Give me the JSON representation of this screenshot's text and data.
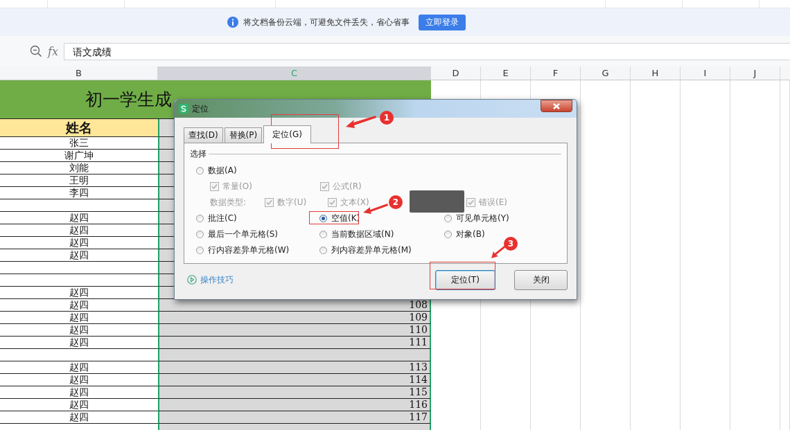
{
  "notice_bar": {
    "message": "将文档备份云端，可避免文件丢失，省心省事",
    "button": "立即登录"
  },
  "formula_bar": {
    "fx": "fx",
    "value": "语文成绩"
  },
  "columns": [
    {
      "label": "B",
      "selected": false
    },
    {
      "label": "C",
      "selected": true
    },
    {
      "label": "D",
      "selected": false
    },
    {
      "label": "E",
      "selected": false
    },
    {
      "label": "F",
      "selected": false
    },
    {
      "label": "G",
      "selected": false
    },
    {
      "label": "H",
      "selected": false
    },
    {
      "label": "I",
      "selected": false
    },
    {
      "label": "J",
      "selected": false
    }
  ],
  "sheet": {
    "title": "初一学生成",
    "header": "姓名",
    "rows": [
      {
        "kind": "entry",
        "name": "张三"
      },
      {
        "kind": "entry",
        "name": "谢广坤"
      },
      {
        "kind": "entry",
        "name": "刘能"
      },
      {
        "kind": "entry",
        "name": "王明"
      },
      {
        "kind": "entry",
        "name": "李四"
      },
      {
        "kind": "blank"
      },
      {
        "kind": "entry",
        "name": "赵四"
      },
      {
        "kind": "entry",
        "name": "赵四"
      },
      {
        "kind": "entry",
        "name": "赵四"
      },
      {
        "kind": "entry",
        "name": "赵四"
      },
      {
        "kind": "blank"
      },
      {
        "kind": "blank"
      },
      {
        "kind": "entry",
        "name": "赵四"
      },
      {
        "kind": "entry",
        "name": "赵四",
        "score": "108"
      },
      {
        "kind": "entry",
        "name": "赵四",
        "score": "109"
      },
      {
        "kind": "entry",
        "name": "赵四",
        "score": "110"
      },
      {
        "kind": "entry",
        "name": "赵四",
        "score": "111"
      },
      {
        "kind": "blank"
      },
      {
        "kind": "entry",
        "name": "赵四",
        "score": "113"
      },
      {
        "kind": "entry",
        "name": "赵四",
        "score": "114"
      },
      {
        "kind": "entry",
        "name": "赵四",
        "score": "115"
      },
      {
        "kind": "entry",
        "name": "赵四",
        "score": "116"
      },
      {
        "kind": "entry",
        "name": "赵四",
        "score": "117"
      },
      {
        "kind": "blank"
      }
    ]
  },
  "dialog": {
    "title": "定位",
    "tabs": [
      {
        "label": "查找(D)",
        "selected": false
      },
      {
        "label": "替换(P)",
        "selected": false
      },
      {
        "label": "定位(G)",
        "selected": true
      }
    ],
    "group_label": "选择",
    "option_rows": [
      {
        "kind": "radios",
        "items": [
          {
            "label": "数据(A)",
            "selected": false
          }
        ]
      },
      {
        "kind": "checks",
        "items": [
          {
            "label": "常量(O)",
            "checked": true,
            "disabled": true
          },
          {
            "label": "公式(R)",
            "checked": true,
            "disabled": true
          }
        ]
      },
      {
        "kind": "checks",
        "caption": "数据类型:",
        "items": [
          {
            "label": "数字(U)",
            "checked": true,
            "disabled": true
          },
          {
            "label": "文本(X)",
            "checked": true,
            "disabled": true
          },
          {
            "label": "错误(E)",
            "checked": true,
            "disabled": true
          }
        ]
      },
      {
        "kind": "radios",
        "items": [
          {
            "label": "批注(C)",
            "selected": false
          },
          {
            "label": "空值(K)",
            "selected": true
          },
          {
            "label": "可见单元格(Y)",
            "selected": false
          }
        ]
      },
      {
        "kind": "radios",
        "items": [
          {
            "label": "最后一个单元格(S)",
            "selected": false
          },
          {
            "label": "当前数据区域(N)",
            "selected": false
          },
          {
            "label": "对象(B)",
            "selected": false
          }
        ]
      },
      {
        "kind": "radios",
        "items": [
          {
            "label": "行内容差异单元格(W)",
            "selected": false
          },
          {
            "label": "列内容差异单元格(M)",
            "selected": false
          }
        ]
      }
    ],
    "tips_link": "操作技巧",
    "buttons": [
      {
        "label": "定位(T)",
        "default": true
      },
      {
        "label": "关闭",
        "default": false
      }
    ]
  },
  "annotations": [
    {
      "number": "1"
    },
    {
      "number": "2"
    },
    {
      "number": "3"
    }
  ]
}
